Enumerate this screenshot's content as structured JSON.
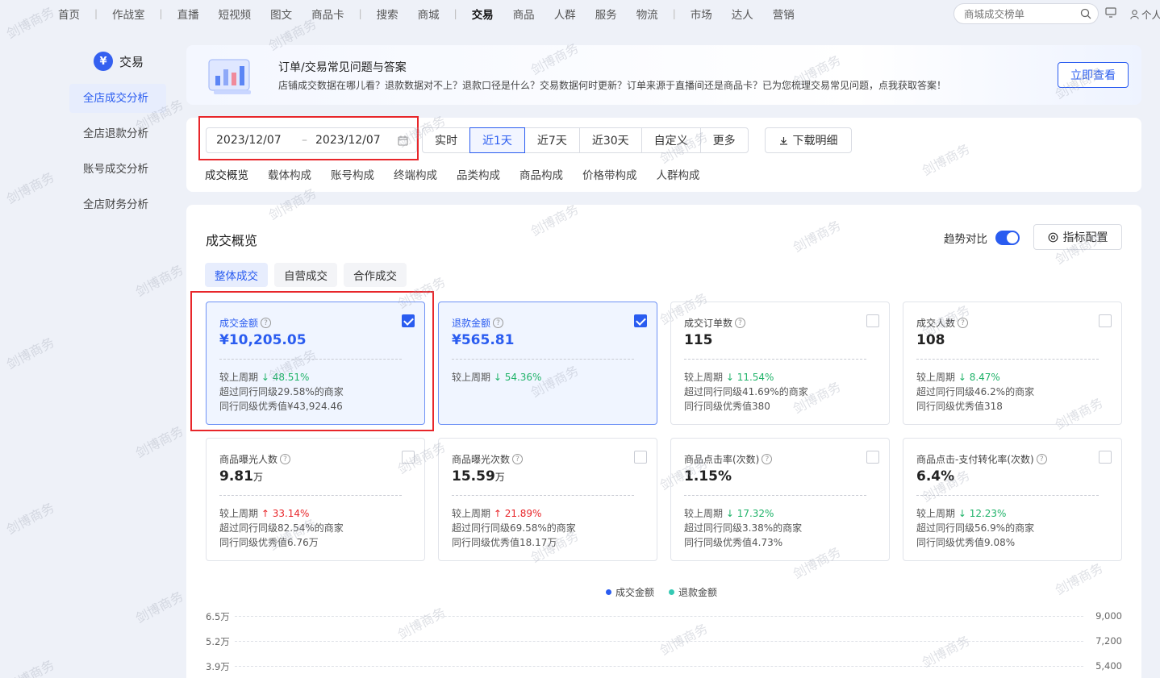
{
  "topnav": {
    "items": [
      "首页",
      "|",
      "作战室",
      "|",
      "直播",
      "短视频",
      "图文",
      "商品卡",
      "|",
      "搜索",
      "商城",
      "|",
      "交易",
      "商品",
      "人群",
      "服务",
      "物流",
      "|",
      "市场",
      "达人",
      "营销"
    ],
    "active": "交易",
    "search_placeholder": "商城成交榜单",
    "user_label": "个人"
  },
  "sidebar": {
    "section_title": "交易",
    "items": [
      "全店成交分析",
      "全店退款分析",
      "账号成交分析",
      "全店财务分析"
    ]
  },
  "banner": {
    "title": "订单/交易常见问题与答案",
    "desc": "店铺成交数据在哪儿看？退款数据对不上？退款口径是什么？交易数据何时更新？订单来源于直播间还是商品卡？已为您梳理交易常见问题，点我获取答案！",
    "button": "立即查看"
  },
  "filter": {
    "date_start": "2023/12/07",
    "date_sep": "–",
    "date_end": "2023/12/07",
    "ranges": [
      "实时",
      "近1天",
      "近7天",
      "近30天",
      "自定义",
      "更多"
    ],
    "active_range": "近1天",
    "download": "下载明细",
    "subtabs": [
      "成交概览",
      "载体构成",
      "账号构成",
      "终端构成",
      "品类构成",
      "商品构成",
      "价格带构成",
      "人群构成"
    ]
  },
  "overview": {
    "title": "成交概览",
    "trend_label": "趋势对比",
    "config_button": "指标配置",
    "tabs": [
      "整体成交",
      "自营成交",
      "合作成交"
    ],
    "cards": [
      {
        "label": "成交金额",
        "value": "¥10,205.05",
        "unit": "",
        "checked": true,
        "compare_prefix": "较上周期",
        "dir": "down",
        "compare": "48.51%",
        "line2": "超过同行同级29.58%的商家",
        "line3": "同行同级优秀值¥43,924.46"
      },
      {
        "label": "退款金额",
        "value": "¥565.81",
        "unit": "",
        "checked": true,
        "compare_prefix": "较上周期",
        "dir": "down",
        "compare": "54.36%",
        "line2": "",
        "line3": ""
      },
      {
        "label": "成交订单数",
        "value": "115",
        "unit": "",
        "checked": false,
        "compare_prefix": "较上周期",
        "dir": "down",
        "compare": "11.54%",
        "line2": "超过同行同级41.69%的商家",
        "line3": "同行同级优秀值380"
      },
      {
        "label": "成交人数",
        "value": "108",
        "unit": "",
        "checked": false,
        "compare_prefix": "较上周期",
        "dir": "down",
        "compare": "8.47%",
        "line2": "超过同行同级46.2%的商家",
        "line3": "同行同级优秀值318"
      },
      {
        "label": "商品曝光人数",
        "value": "9.81",
        "unit": "万",
        "checked": false,
        "compare_prefix": "较上周期",
        "dir": "up",
        "compare": "33.14%",
        "line2": "超过同行同级82.54%的商家",
        "line3": "同行同级优秀值6.76万"
      },
      {
        "label": "商品曝光次数",
        "value": "15.59",
        "unit": "万",
        "checked": false,
        "compare_prefix": "较上周期",
        "dir": "up",
        "compare": "21.89%",
        "line2": "超过同行同级69.58%的商家",
        "line3": "同行同级优秀值18.17万"
      },
      {
        "label": "商品点击率(次数)",
        "value": "1.15%",
        "unit": "",
        "checked": false,
        "compare_prefix": "较上周期",
        "dir": "down",
        "compare": "17.32%",
        "line2": "超过同行同级3.38%的商家",
        "line3": "同行同级优秀值4.73%"
      },
      {
        "label": "商品点击-支付转化率(次数)",
        "value": "6.4%",
        "unit": "",
        "checked": false,
        "compare_prefix": "较上周期",
        "dir": "down",
        "compare": "12.23%",
        "line2": "超过同行同级56.9%的商家",
        "line3": "同行同级优秀值9.08%"
      }
    ],
    "legend": [
      {
        "name": "成交金额",
        "color": "#2a5cf0"
      },
      {
        "name": "退款金额",
        "color": "#35c9b4"
      }
    ],
    "axis": {
      "left": [
        "6.5万",
        "5.2万",
        "3.9万"
      ],
      "right": [
        "9,000",
        "7,200",
        "5,400"
      ]
    }
  },
  "watermark": "剑博商务",
  "colors": {
    "accent": "#2a5cf0",
    "up": "#e8262a",
    "down": "#21b36a",
    "highlight_box": "#e8262a"
  }
}
